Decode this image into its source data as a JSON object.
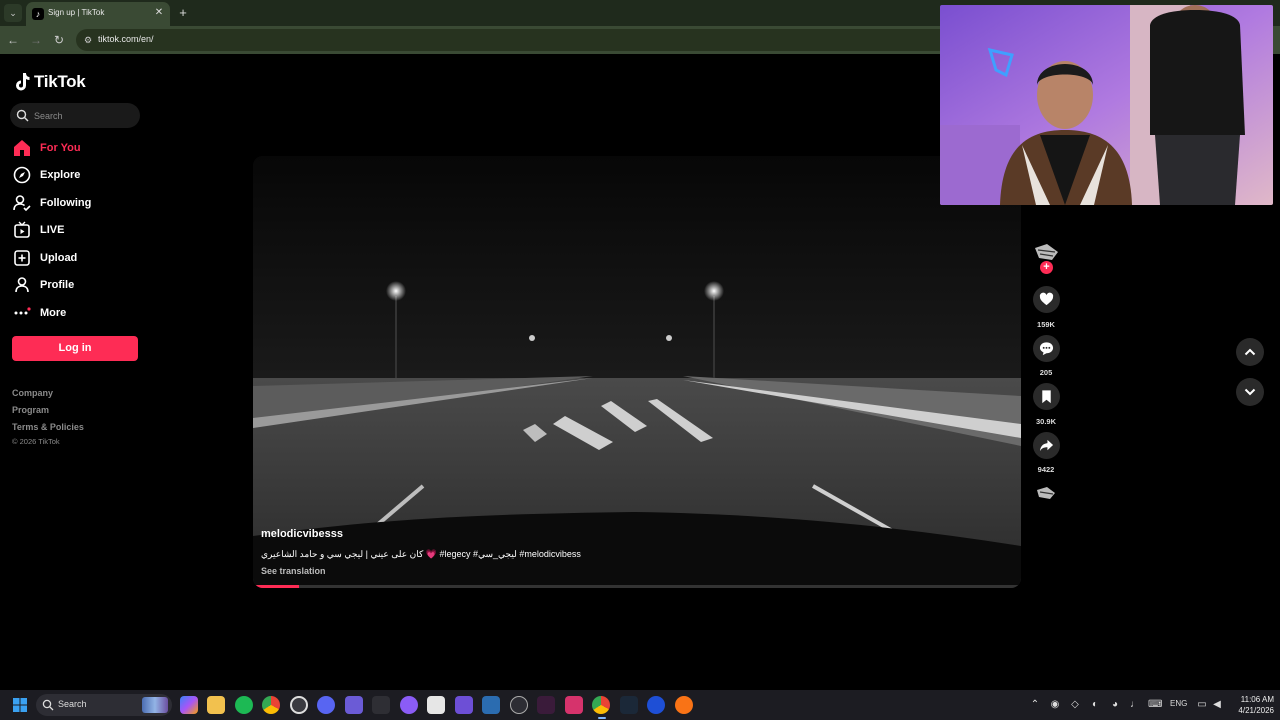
{
  "browser": {
    "tab_title": "Sign up | TikTok",
    "url": "tiktok.com/en/"
  },
  "sidebar": {
    "brand": "TikTok",
    "search_placeholder": "Search",
    "nav": [
      {
        "label": "For You",
        "icon": "home-icon",
        "active": true
      },
      {
        "label": "Explore",
        "icon": "compass-icon"
      },
      {
        "label": "Following",
        "icon": "following-icon"
      },
      {
        "label": "LIVE",
        "icon": "live-icon"
      },
      {
        "label": "Upload",
        "icon": "upload-icon"
      },
      {
        "label": "Profile",
        "icon": "profile-icon"
      },
      {
        "label": "More",
        "icon": "more-icon"
      }
    ],
    "login_label": "Log in",
    "footer_links": [
      "Company",
      "Program",
      "Terms & Policies"
    ],
    "copyright": "© 2026 TikTok"
  },
  "video": {
    "author": "melodicvibesss",
    "caption": "كان على عيني | ليجي سي و حامد الشاعيري 💗 #legecy #ليجي_سي #melodicvibess",
    "see_translation": "See translation",
    "progress": 0.06
  },
  "actions": {
    "likes": "159K",
    "comments": "205",
    "saves": "30.9K",
    "shares": "9422"
  },
  "taskbar": {
    "search_label": "Search",
    "language": "ENG",
    "time": "11:06 AM",
    "date": "4/21/2026"
  },
  "colors": {
    "accent": "#fe2c55",
    "background": "#000000"
  }
}
